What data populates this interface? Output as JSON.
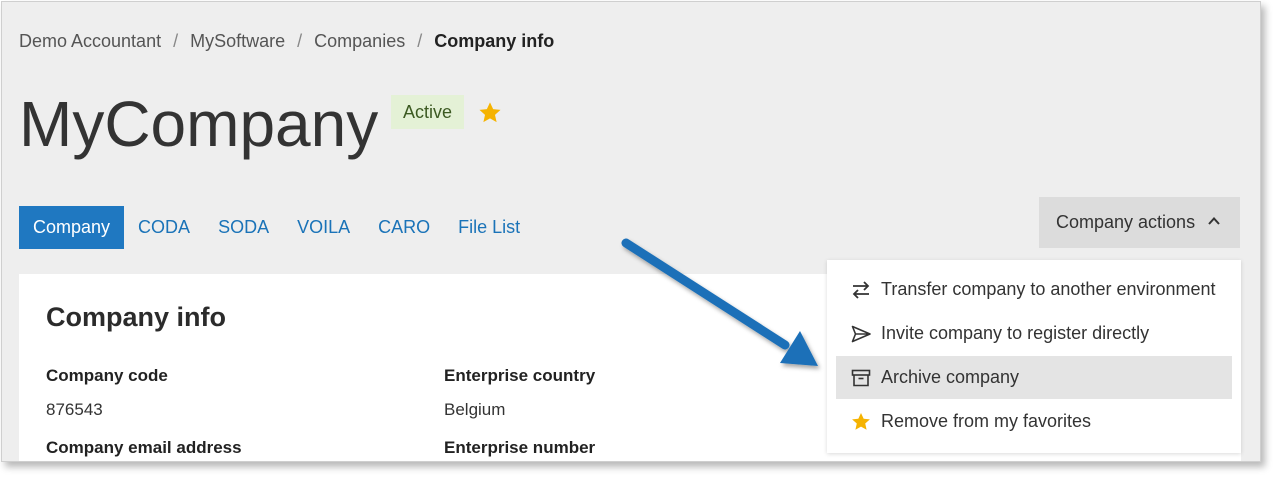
{
  "breadcrumb": {
    "items": [
      "Demo Accountant",
      "MySoftware",
      "Companies"
    ],
    "separator": "/",
    "current": "Company info"
  },
  "header": {
    "title": "MyCompany",
    "status_badge": "Active",
    "favorite_icon": "star-icon"
  },
  "tabs": [
    {
      "label": "Company",
      "active": true
    },
    {
      "label": "CODA"
    },
    {
      "label": "SODA"
    },
    {
      "label": "VOILA"
    },
    {
      "label": "CARO"
    },
    {
      "label": "File List"
    }
  ],
  "actions": {
    "label": "Company actions",
    "icon": "chevron-up-icon",
    "menu": [
      {
        "label": "Transfer company to another environment",
        "icon": "transfer-arrows-icon"
      },
      {
        "label": "Invite company to register directly",
        "icon": "send-icon"
      },
      {
        "label": "Archive company",
        "icon": "archive-box-icon",
        "highlighted": true
      },
      {
        "label": "Remove from my favorites",
        "icon": "star-icon"
      }
    ]
  },
  "card": {
    "title": "Company info",
    "fields": [
      {
        "label": "Company code",
        "value": "876543"
      },
      {
        "label": "Enterprise country",
        "value": "Belgium"
      },
      {
        "label": "Company email address",
        "value": ""
      },
      {
        "label": "Enterprise number",
        "value": ""
      }
    ]
  },
  "colors": {
    "primary": "#1f78c1",
    "link": "#1a73b8",
    "badge_bg": "#e4f1d6",
    "star": "#f5b301",
    "annotation_arrow": "#1a6fb8"
  }
}
